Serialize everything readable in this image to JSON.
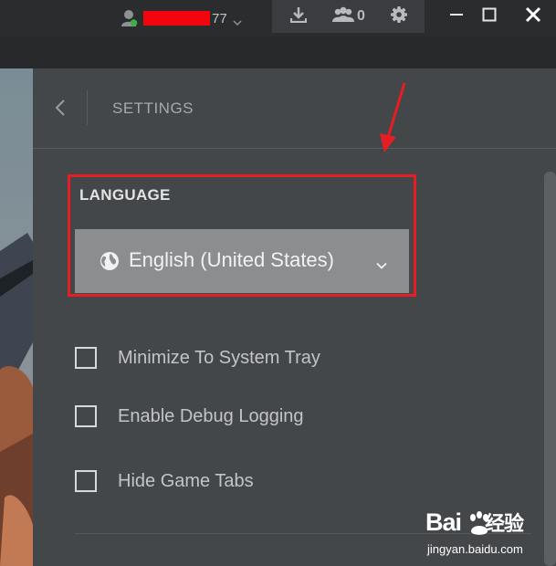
{
  "titlebar": {
    "username_suffix": "77",
    "friends_count": "0",
    "icons": {
      "user": "user-online-icon",
      "download": "download-icon",
      "friends": "friends-icon",
      "settings": "gear-icon",
      "minimize": "minimize-icon",
      "maximize": "maximize-icon",
      "close": "close-icon"
    },
    "status_color": "#3cb043"
  },
  "settings": {
    "title": "SETTINGS",
    "back_icon": "chevron-left-icon",
    "language": {
      "label": "LANGUAGE",
      "selected": "English (United States)",
      "globe_icon": "globe-icon",
      "chevron_icon": "chevron-down-icon"
    },
    "options": [
      {
        "label": "Minimize To System Tray",
        "checked": false
      },
      {
        "label": "Enable Debug Logging",
        "checked": false
      },
      {
        "label": "Hide Game Tabs",
        "checked": false
      }
    ]
  },
  "annotation": {
    "highlight_color": "#e61e23"
  },
  "watermark": {
    "logo": "Bai",
    "logo_tail": "经验",
    "url": "jingyan.baidu.com"
  }
}
